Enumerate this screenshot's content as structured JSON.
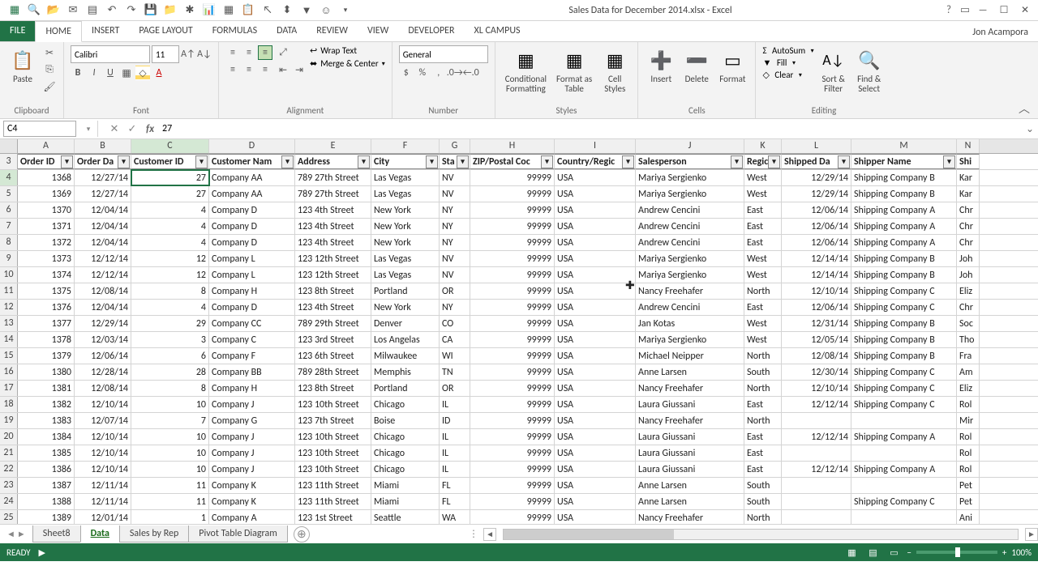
{
  "app_title": "Sales Data for December 2014.xlsx - Excel",
  "user_name": "Jon Acampora",
  "tabs": [
    "FILE",
    "HOME",
    "INSERT",
    "PAGE LAYOUT",
    "FORMULAS",
    "DATA",
    "REVIEW",
    "VIEW",
    "DEVELOPER",
    "XL Campus"
  ],
  "ribbon": {
    "clipboard": {
      "label": "Clipboard",
      "paste": "Paste"
    },
    "font": {
      "label": "Font",
      "name": "Calibri",
      "size": "11"
    },
    "alignment": {
      "label": "Alignment",
      "wrap": "Wrap Text",
      "merge": "Merge & Center"
    },
    "number": {
      "label": "Number",
      "format": "General"
    },
    "styles": {
      "label": "Styles",
      "cond": "Conditional\nFormatting",
      "table": "Format as\nTable",
      "cell": "Cell\nStyles"
    },
    "cells": {
      "label": "Cells",
      "insert": "Insert",
      "delete": "Delete",
      "format": "Format"
    },
    "editing": {
      "label": "Editing",
      "sum": "AutoSum",
      "fill": "Fill",
      "clear": "Clear",
      "sort": "Sort &\nFilter",
      "find": "Find &\nSelect"
    }
  },
  "namebox": "C4",
  "formula": "27",
  "col_letters": [
    "A",
    "B",
    "C",
    "D",
    "E",
    "F",
    "G",
    "H",
    "I",
    "J",
    "K",
    "L",
    "M",
    "N"
  ],
  "headers": [
    "Order ID",
    "Order Da",
    "Customer ID",
    "Customer Nam",
    "Address",
    "City",
    "Sta",
    "ZIP/Postal Coc",
    "Country/Regic",
    "Salesperson",
    "Regic",
    "Shipped Da",
    "Shipper Name",
    "Shi"
  ],
  "rows": [
    {
      "n": "4",
      "d": [
        "1368",
        "12/27/14",
        "27",
        "Company AA",
        "789 27th Street",
        "Las Vegas",
        "NV",
        "99999",
        "USA",
        "Mariya Sergienko",
        "West",
        "12/29/14",
        "Shipping Company B",
        "Kar"
      ]
    },
    {
      "n": "5",
      "d": [
        "1369",
        "12/27/14",
        "27",
        "Company AA",
        "789 27th Street",
        "Las Vegas",
        "NV",
        "99999",
        "USA",
        "Mariya Sergienko",
        "West",
        "12/29/14",
        "Shipping Company B",
        "Kar"
      ]
    },
    {
      "n": "6",
      "d": [
        "1370",
        "12/04/14",
        "4",
        "Company D",
        "123 4th Street",
        "New York",
        "NY",
        "99999",
        "USA",
        "Andrew Cencini",
        "East",
        "12/06/14",
        "Shipping Company A",
        "Chr"
      ]
    },
    {
      "n": "7",
      "d": [
        "1371",
        "12/04/14",
        "4",
        "Company D",
        "123 4th Street",
        "New York",
        "NY",
        "99999",
        "USA",
        "Andrew Cencini",
        "East",
        "12/06/14",
        "Shipping Company A",
        "Chr"
      ]
    },
    {
      "n": "8",
      "d": [
        "1372",
        "12/04/14",
        "4",
        "Company D",
        "123 4th Street",
        "New York",
        "NY",
        "99999",
        "USA",
        "Andrew Cencini",
        "East",
        "12/06/14",
        "Shipping Company A",
        "Chr"
      ]
    },
    {
      "n": "9",
      "d": [
        "1373",
        "12/12/14",
        "12",
        "Company L",
        "123 12th Street",
        "Las Vegas",
        "NV",
        "99999",
        "USA",
        "Mariya Sergienko",
        "West",
        "12/14/14",
        "Shipping Company B",
        "Joh"
      ]
    },
    {
      "n": "10",
      "d": [
        "1374",
        "12/12/14",
        "12",
        "Company L",
        "123 12th Street",
        "Las Vegas",
        "NV",
        "99999",
        "USA",
        "Mariya Sergienko",
        "West",
        "12/14/14",
        "Shipping Company B",
        "Joh"
      ]
    },
    {
      "n": "11",
      "d": [
        "1375",
        "12/08/14",
        "8",
        "Company H",
        "123 8th Street",
        "Portland",
        "OR",
        "99999",
        "USA",
        "Nancy Freehafer",
        "North",
        "12/10/14",
        "Shipping Company C",
        "Eliz"
      ]
    },
    {
      "n": "12",
      "d": [
        "1376",
        "12/04/14",
        "4",
        "Company D",
        "123 4th Street",
        "New York",
        "NY",
        "99999",
        "USA",
        "Andrew Cencini",
        "East",
        "12/06/14",
        "Shipping Company C",
        "Chr"
      ]
    },
    {
      "n": "13",
      "d": [
        "1377",
        "12/29/14",
        "29",
        "Company CC",
        "789 29th Street",
        "Denver",
        "CO",
        "99999",
        "USA",
        "Jan Kotas",
        "West",
        "12/31/14",
        "Shipping Company B",
        "Soc"
      ]
    },
    {
      "n": "14",
      "d": [
        "1378",
        "12/03/14",
        "3",
        "Company C",
        "123 3rd Street",
        "Los Angelas",
        "CA",
        "99999",
        "USA",
        "Mariya Sergienko",
        "West",
        "12/05/14",
        "Shipping Company B",
        "Tho"
      ]
    },
    {
      "n": "15",
      "d": [
        "1379",
        "12/06/14",
        "6",
        "Company F",
        "123 6th Street",
        "Milwaukee",
        "WI",
        "99999",
        "USA",
        "Michael Neipper",
        "North",
        "12/08/14",
        "Shipping Company B",
        "Fra"
      ]
    },
    {
      "n": "16",
      "d": [
        "1380",
        "12/28/14",
        "28",
        "Company BB",
        "789 28th Street",
        "Memphis",
        "TN",
        "99999",
        "USA",
        "Anne Larsen",
        "South",
        "12/30/14",
        "Shipping Company C",
        "Am"
      ]
    },
    {
      "n": "17",
      "d": [
        "1381",
        "12/08/14",
        "8",
        "Company H",
        "123 8th Street",
        "Portland",
        "OR",
        "99999",
        "USA",
        "Nancy Freehafer",
        "North",
        "12/10/14",
        "Shipping Company C",
        "Eliz"
      ]
    },
    {
      "n": "18",
      "d": [
        "1382",
        "12/10/14",
        "10",
        "Company J",
        "123 10th Street",
        "Chicago",
        "IL",
        "99999",
        "USA",
        "Laura Giussani",
        "East",
        "12/12/14",
        "Shipping Company C",
        "Rol"
      ]
    },
    {
      "n": "19",
      "d": [
        "1383",
        "12/07/14",
        "7",
        "Company G",
        "123 7th Street",
        "Boise",
        "ID",
        "99999",
        "USA",
        "Nancy Freehafer",
        "North",
        "",
        "",
        "Mir"
      ]
    },
    {
      "n": "20",
      "d": [
        "1384",
        "12/10/14",
        "10",
        "Company J",
        "123 10th Street",
        "Chicago",
        "IL",
        "99999",
        "USA",
        "Laura Giussani",
        "East",
        "12/12/14",
        "Shipping Company A",
        "Rol"
      ]
    },
    {
      "n": "21",
      "d": [
        "1385",
        "12/10/14",
        "10",
        "Company J",
        "123 10th Street",
        "Chicago",
        "IL",
        "99999",
        "USA",
        "Laura Giussani",
        "East",
        "",
        "",
        "Rol"
      ]
    },
    {
      "n": "22",
      "d": [
        "1386",
        "12/10/14",
        "10",
        "Company J",
        "123 10th Street",
        "Chicago",
        "IL",
        "99999",
        "USA",
        "Laura Giussani",
        "East",
        "12/12/14",
        "Shipping Company A",
        "Rol"
      ]
    },
    {
      "n": "23",
      "d": [
        "1387",
        "12/11/14",
        "11",
        "Company K",
        "123 11th Street",
        "Miami",
        "FL",
        "99999",
        "USA",
        "Anne Larsen",
        "South",
        "",
        "",
        "Pet"
      ]
    },
    {
      "n": "24",
      "d": [
        "1388",
        "12/11/14",
        "11",
        "Company K",
        "123 11th Street",
        "Miami",
        "FL",
        "99999",
        "USA",
        "Anne Larsen",
        "South",
        "",
        "Shipping Company C",
        "Pet"
      ]
    },
    {
      "n": "25",
      "d": [
        "1389",
        "12/01/14",
        "1",
        "Company A",
        "123 1st Street",
        "Seattle",
        "WA",
        "99999",
        "USA",
        "Nancy Freehafer",
        "North",
        "",
        "",
        "Ani"
      ]
    }
  ],
  "sheets": [
    "Sheet8",
    "Data",
    "Sales by Rep",
    "Pivot Table Diagram"
  ],
  "active_sheet": 1,
  "status": {
    "ready": "READY",
    "zoom": "100%"
  },
  "right_align_cols": [
    0,
    1,
    2,
    7,
    11
  ],
  "header_row_num": "3"
}
